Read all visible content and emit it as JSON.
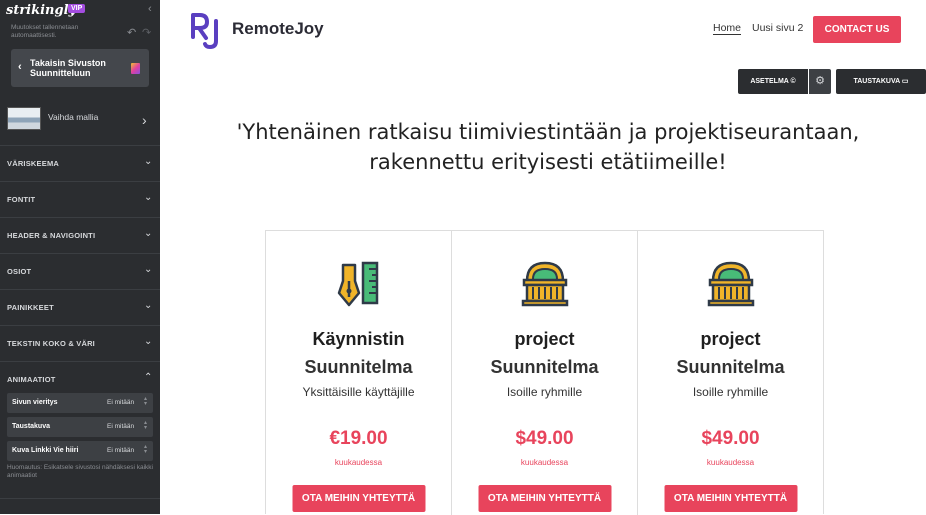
{
  "sidebar": {
    "brand": "strikingly",
    "vip_badge": "VIP",
    "autosave_text": "Muutokset tallennetaan automaattisesti.",
    "back_button_label": "Takaisin Sivuston Suunnitteluun",
    "template_label": "Vaihda mallia",
    "sections": [
      {
        "label": "VÄRISKEEMA"
      },
      {
        "label": "FONTIT"
      },
      {
        "label": "HEADER & NAVIGOINTI"
      },
      {
        "label": "OSIOT"
      },
      {
        "label": "PAINIKKEET"
      },
      {
        "label": "TEKSTIN KOKO & VÄRI"
      },
      {
        "label": "ANIMAATIOT"
      }
    ],
    "animations": [
      {
        "key": "Sivun vieritys",
        "value": "Ei mitään"
      },
      {
        "key": "Taustakuva",
        "value": "Ei mitään"
      },
      {
        "key": "Kuva Linkki Vie hiiri",
        "value": "Ei mitään"
      }
    ],
    "animation_note": "Huomautus: Esikatsele sivustosi nähdäksesi kaikki animaatiot"
  },
  "header": {
    "logo_mark": "RJ",
    "logo_text": "RemoteJoy",
    "nav": {
      "home": "Home",
      "page2": "Uusi sivu 2"
    },
    "contact_button": "CONTACT US"
  },
  "editor_toolbar": {
    "layout_label": "ASETELMA ©",
    "background_label": "TAUSTAKUVA"
  },
  "hero": {
    "line1": "'Yhtenäinen ratkaisu tiimiviestintään ja projektiseurantaan,",
    "line2": "rakennettu erityisesti etätiimeille!"
  },
  "plans": [
    {
      "icon": "pen-ruler-icon",
      "name": "Käynnistin",
      "tier": "Suunnitelma",
      "desc": "Yksittäisille käyttäjille",
      "price": "€19.00",
      "period": "kuukaudessa",
      "button": "OTA MEIHIN YHTEYTTÄ"
    },
    {
      "icon": "building-icon",
      "name": "project",
      "tier": "Suunnitelma",
      "desc": "Isoille ryhmille",
      "price": "$49.00",
      "period": "kuukaudessa",
      "button": "OTA MEIHIN YHTEYTTÄ"
    },
    {
      "icon": "building-icon",
      "name": "project",
      "tier": "Suunnitelma",
      "desc": "Isoille ryhmille",
      "price": "$49.00",
      "period": "kuukaudessa",
      "button": "OTA MEIHIN YHTEYTTÄ"
    }
  ],
  "colors": {
    "accent": "#e8445c",
    "sidebar_bg": "#2b2d30",
    "logo_purple": "#5a3fc0"
  }
}
